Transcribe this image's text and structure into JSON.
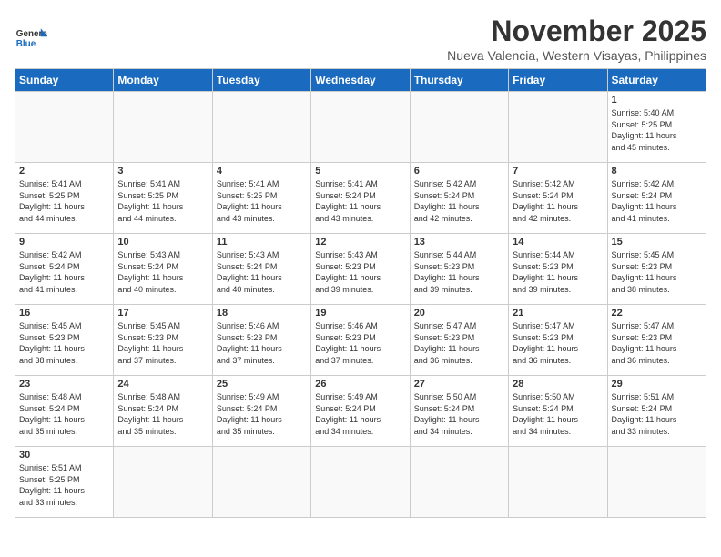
{
  "header": {
    "logo_general": "General",
    "logo_blue": "Blue",
    "month_title": "November 2025",
    "subtitle": "Nueva Valencia, Western Visayas, Philippines"
  },
  "days_of_week": [
    "Sunday",
    "Monday",
    "Tuesday",
    "Wednesday",
    "Thursday",
    "Friday",
    "Saturday"
  ],
  "weeks": [
    [
      {
        "day": "",
        "info": ""
      },
      {
        "day": "",
        "info": ""
      },
      {
        "day": "",
        "info": ""
      },
      {
        "day": "",
        "info": ""
      },
      {
        "day": "",
        "info": ""
      },
      {
        "day": "",
        "info": ""
      },
      {
        "day": "1",
        "info": "Sunrise: 5:40 AM\nSunset: 5:25 PM\nDaylight: 11 hours\nand 45 minutes."
      }
    ],
    [
      {
        "day": "2",
        "info": "Sunrise: 5:41 AM\nSunset: 5:25 PM\nDaylight: 11 hours\nand 44 minutes."
      },
      {
        "day": "3",
        "info": "Sunrise: 5:41 AM\nSunset: 5:25 PM\nDaylight: 11 hours\nand 44 minutes."
      },
      {
        "day": "4",
        "info": "Sunrise: 5:41 AM\nSunset: 5:25 PM\nDaylight: 11 hours\nand 43 minutes."
      },
      {
        "day": "5",
        "info": "Sunrise: 5:41 AM\nSunset: 5:24 PM\nDaylight: 11 hours\nand 43 minutes."
      },
      {
        "day": "6",
        "info": "Sunrise: 5:42 AM\nSunset: 5:24 PM\nDaylight: 11 hours\nand 42 minutes."
      },
      {
        "day": "7",
        "info": "Sunrise: 5:42 AM\nSunset: 5:24 PM\nDaylight: 11 hours\nand 42 minutes."
      },
      {
        "day": "8",
        "info": "Sunrise: 5:42 AM\nSunset: 5:24 PM\nDaylight: 11 hours\nand 41 minutes."
      }
    ],
    [
      {
        "day": "9",
        "info": "Sunrise: 5:42 AM\nSunset: 5:24 PM\nDaylight: 11 hours\nand 41 minutes."
      },
      {
        "day": "10",
        "info": "Sunrise: 5:43 AM\nSunset: 5:24 PM\nDaylight: 11 hours\nand 40 minutes."
      },
      {
        "day": "11",
        "info": "Sunrise: 5:43 AM\nSunset: 5:24 PM\nDaylight: 11 hours\nand 40 minutes."
      },
      {
        "day": "12",
        "info": "Sunrise: 5:43 AM\nSunset: 5:23 PM\nDaylight: 11 hours\nand 39 minutes."
      },
      {
        "day": "13",
        "info": "Sunrise: 5:44 AM\nSunset: 5:23 PM\nDaylight: 11 hours\nand 39 minutes."
      },
      {
        "day": "14",
        "info": "Sunrise: 5:44 AM\nSunset: 5:23 PM\nDaylight: 11 hours\nand 39 minutes."
      },
      {
        "day": "15",
        "info": "Sunrise: 5:45 AM\nSunset: 5:23 PM\nDaylight: 11 hours\nand 38 minutes."
      }
    ],
    [
      {
        "day": "16",
        "info": "Sunrise: 5:45 AM\nSunset: 5:23 PM\nDaylight: 11 hours\nand 38 minutes."
      },
      {
        "day": "17",
        "info": "Sunrise: 5:45 AM\nSunset: 5:23 PM\nDaylight: 11 hours\nand 37 minutes."
      },
      {
        "day": "18",
        "info": "Sunrise: 5:46 AM\nSunset: 5:23 PM\nDaylight: 11 hours\nand 37 minutes."
      },
      {
        "day": "19",
        "info": "Sunrise: 5:46 AM\nSunset: 5:23 PM\nDaylight: 11 hours\nand 37 minutes."
      },
      {
        "day": "20",
        "info": "Sunrise: 5:47 AM\nSunset: 5:23 PM\nDaylight: 11 hours\nand 36 minutes."
      },
      {
        "day": "21",
        "info": "Sunrise: 5:47 AM\nSunset: 5:23 PM\nDaylight: 11 hours\nand 36 minutes."
      },
      {
        "day": "22",
        "info": "Sunrise: 5:47 AM\nSunset: 5:23 PM\nDaylight: 11 hours\nand 36 minutes."
      }
    ],
    [
      {
        "day": "23",
        "info": "Sunrise: 5:48 AM\nSunset: 5:24 PM\nDaylight: 11 hours\nand 35 minutes."
      },
      {
        "day": "24",
        "info": "Sunrise: 5:48 AM\nSunset: 5:24 PM\nDaylight: 11 hours\nand 35 minutes."
      },
      {
        "day": "25",
        "info": "Sunrise: 5:49 AM\nSunset: 5:24 PM\nDaylight: 11 hours\nand 35 minutes."
      },
      {
        "day": "26",
        "info": "Sunrise: 5:49 AM\nSunset: 5:24 PM\nDaylight: 11 hours\nand 34 minutes."
      },
      {
        "day": "27",
        "info": "Sunrise: 5:50 AM\nSunset: 5:24 PM\nDaylight: 11 hours\nand 34 minutes."
      },
      {
        "day": "28",
        "info": "Sunrise: 5:50 AM\nSunset: 5:24 PM\nDaylight: 11 hours\nand 34 minutes."
      },
      {
        "day": "29",
        "info": "Sunrise: 5:51 AM\nSunset: 5:24 PM\nDaylight: 11 hours\nand 33 minutes."
      }
    ],
    [
      {
        "day": "30",
        "info": "Sunrise: 5:51 AM\nSunset: 5:25 PM\nDaylight: 11 hours\nand 33 minutes."
      },
      {
        "day": "",
        "info": ""
      },
      {
        "day": "",
        "info": ""
      },
      {
        "day": "",
        "info": ""
      },
      {
        "day": "",
        "info": ""
      },
      {
        "day": "",
        "info": ""
      },
      {
        "day": "",
        "info": ""
      }
    ]
  ]
}
